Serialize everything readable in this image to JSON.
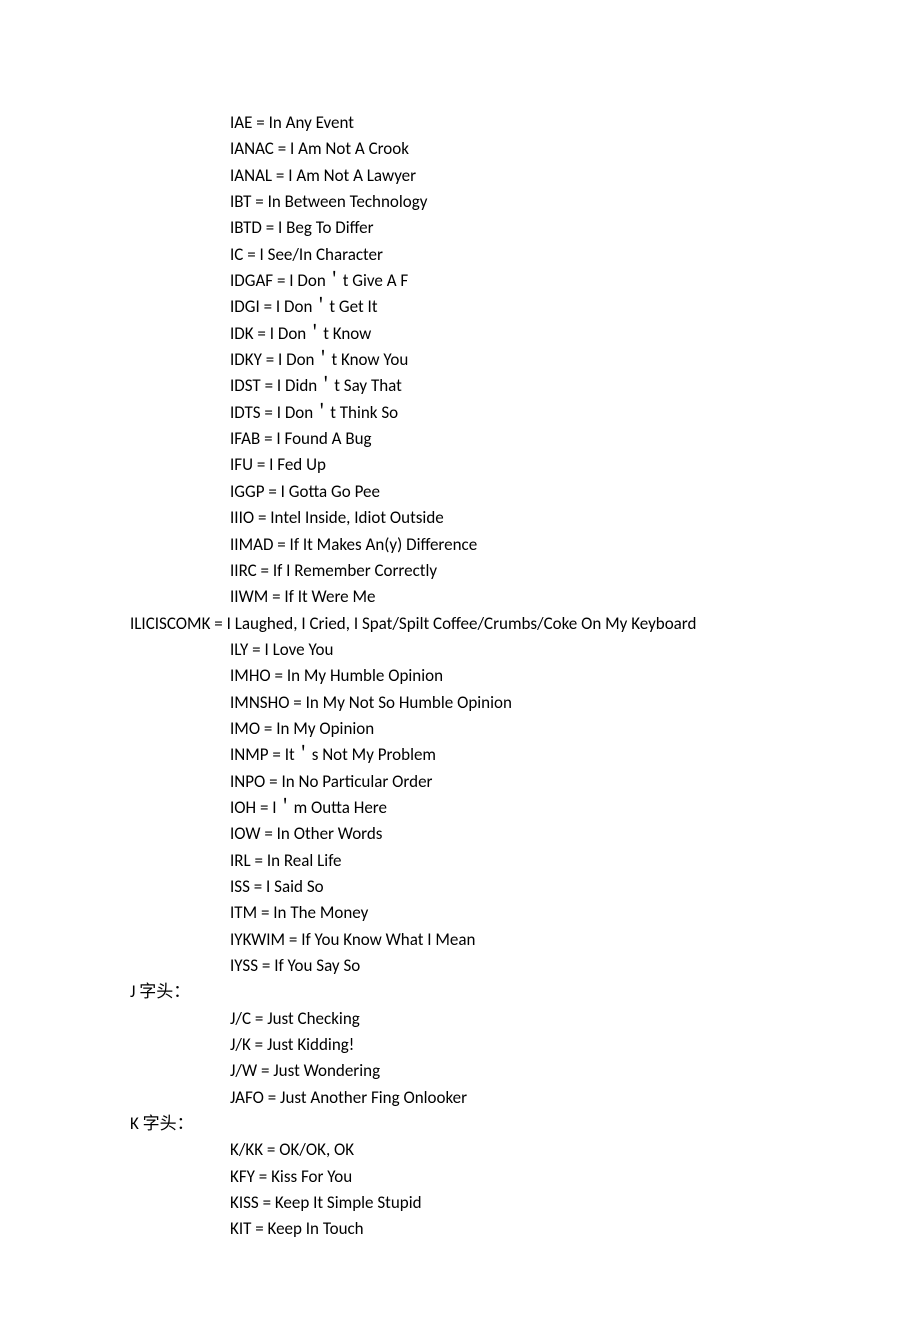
{
  "sections": [
    {
      "heading": null,
      "entries": [
        "IAE = In Any Event",
        "IANAC = I Am Not A Crook",
        "IANAL = I Am Not A Lawyer",
        "IBT = In Between Technology",
        "IBTD = I Beg To Differ",
        "IC = I See/In Character",
        "IDGAF = I Don＇t Give A F",
        "IDGI = I Don＇t Get It",
        "IDK = I Don＇t Know",
        "IDKY = I Don＇t Know You",
        "IDST = I Didn＇t Say That",
        "IDTS = I Don＇t Think So",
        "IFAB = I Found A Bug",
        "IFU = I Fed Up",
        "IGGP = I Gotta Go Pee",
        "IIIO = Intel Inside, Idiot Outside",
        "IIMAD = If It Makes An(y) Difference",
        "IIRC = If I Remember Correctly",
        "IIWM = If It Were Me",
        " ILICISCOMK = I Laughed, I Cried, I Spat/Spilt Coffee/Crumbs/Coke On My Keyboard",
        "ILY = I Love You",
        "IMHO = In My Humble Opinion",
        "IMNSHO = In My Not So Humble Opinion",
        "IMO = In My Opinion",
        "INMP = It＇s Not My Problem",
        "INPO = In No Particular Order",
        "IOH = I＇m Outta Here",
        "IOW = In Other Words",
        "IRL = In Real Life",
        "ISS = I Said So",
        "ITM = In The Money",
        "IYKWIM = If You Know What I Mean",
        "IYSS = If You Say So"
      ]
    },
    {
      "heading": "J 字头：",
      "entries": [
        "J/C = Just Checking",
        "J/K = Just Kidding!",
        "J/W = Just Wondering",
        "JAFO = Just Another Fing Onlooker"
      ]
    },
    {
      "heading": "K 字头：",
      "entries": [
        "K/KK = OK/OK, OK",
        "KFY = Kiss For You",
        "KISS = Keep It Simple Stupid",
        "KIT = Keep In Touch"
      ]
    }
  ]
}
